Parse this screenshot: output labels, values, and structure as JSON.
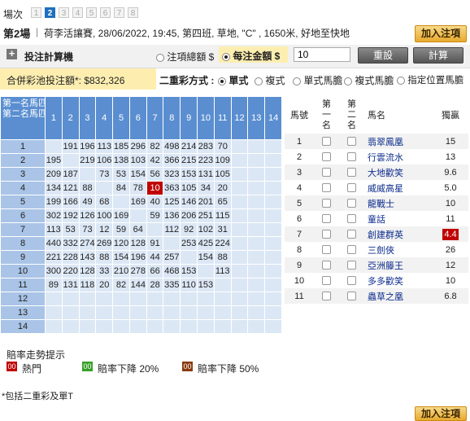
{
  "race_nav": {
    "label": "場次",
    "races": [
      "1",
      "2",
      "3",
      "4",
      "5",
      "6",
      "7",
      "8"
    ],
    "selected": "2"
  },
  "race_info": {
    "race_no": "第2場",
    "details": "荷李活讓賽, 28/06/2022, 19:45, 第四班, 草地, \"C\" , 1650米, 好地至快地"
  },
  "add_bet": "加入注項",
  "calc": {
    "title": "投注計算機",
    "opt_total": "注項總額 $",
    "opt_unit": "每注金額 $",
    "unit_value": "10",
    "reset": "重設",
    "compute": "計算"
  },
  "pool": {
    "label": "合併彩池投注額*: $832,326"
  },
  "quinella": {
    "label": "二重彩方式 :",
    "options": [
      "單式",
      "複式",
      "單式馬膽",
      "複式馬膽",
      "指定位置馬膽"
    ],
    "selected": "單式"
  },
  "matrix": {
    "corner_top": "第一名馬匹",
    "corner_bottom": "第二名馬匹",
    "cols": [
      "1",
      "2",
      "3",
      "4",
      "5",
      "6",
      "7",
      "8",
      "9",
      "10",
      "11",
      "12",
      "13",
      "14"
    ],
    "rows": [
      {
        "n": "1",
        "cells": [
          "",
          "191",
          "196",
          "113",
          "185",
          "296",
          "82",
          "498",
          "214",
          "283",
          "70",
          "",
          "",
          ""
        ]
      },
      {
        "n": "2",
        "cells": [
          "195",
          "",
          "219",
          "106",
          "138",
          "103",
          "42",
          "366",
          "215",
          "223",
          "109",
          "",
          "",
          ""
        ]
      },
      {
        "n": "3",
        "cells": [
          "209",
          "187",
          "",
          "73",
          "53",
          "154",
          "56",
          "323",
          "153",
          "131",
          "105",
          "",
          "",
          ""
        ]
      },
      {
        "n": "4",
        "cells": [
          "134",
          "121",
          "88",
          "",
          "84",
          "78",
          "10",
          "363",
          "105",
          "34",
          "20",
          "",
          "",
          ""
        ]
      },
      {
        "n": "5",
        "cells": [
          "199",
          "166",
          "49",
          "68",
          "",
          "169",
          "40",
          "125",
          "146",
          "201",
          "65",
          "",
          "",
          ""
        ]
      },
      {
        "n": "6",
        "cells": [
          "302",
          "192",
          "126",
          "100",
          "169",
          "",
          "59",
          "136",
          "206",
          "251",
          "115",
          "",
          "",
          ""
        ]
      },
      {
        "n": "7",
        "cells": [
          "113",
          "53",
          "73",
          "12",
          "59",
          "64",
          "",
          "112",
          "92",
          "102",
          "31",
          "",
          "",
          ""
        ]
      },
      {
        "n": "8",
        "cells": [
          "440",
          "332",
          "274",
          "269",
          "120",
          "128",
          "91",
          "",
          "253",
          "425",
          "224",
          "",
          "",
          ""
        ]
      },
      {
        "n": "9",
        "cells": [
          "221",
          "228",
          "143",
          "88",
          "154",
          "196",
          "44",
          "257",
          "",
          "154",
          "88",
          "",
          "",
          ""
        ]
      },
      {
        "n": "10",
        "cells": [
          "300",
          "220",
          "128",
          "33",
          "210",
          "278",
          "66",
          "468",
          "153",
          "",
          "113",
          "",
          "",
          ""
        ]
      },
      {
        "n": "11",
        "cells": [
          "89",
          "131",
          "118",
          "20",
          "82",
          "144",
          "28",
          "335",
          "110",
          "153",
          "",
          "",
          "",
          ""
        ]
      },
      {
        "n": "12",
        "cells": [
          "",
          "",
          "",
          "",
          "",
          "",
          "",
          "",
          "",
          "",
          "",
          "",
          "",
          ""
        ]
      },
      {
        "n": "13",
        "cells": [
          "",
          "",
          "",
          "",
          "",
          "",
          "",
          "",
          "",
          "",
          "",
          "",
          "",
          ""
        ]
      },
      {
        "n": "14",
        "cells": [
          "",
          "",
          "",
          "",
          "",
          "",
          "",
          "",
          "",
          "",
          "",
          "",
          "",
          ""
        ]
      }
    ],
    "hot_cell": {
      "row": "4",
      "col": "7"
    }
  },
  "horses": {
    "headers": {
      "no": "馬號",
      "first": "第一名",
      "second": "第二名",
      "name": "馬名",
      "odds": "獨贏"
    },
    "list": [
      {
        "no": "1",
        "name": "翡翠鳳凰",
        "odds": "15"
      },
      {
        "no": "2",
        "name": "行雲流水",
        "odds": "13"
      },
      {
        "no": "3",
        "name": "大地歡笑",
        "odds": "9.6"
      },
      {
        "no": "4",
        "name": "威威高星",
        "odds": "5.0"
      },
      {
        "no": "5",
        "name": "龍戰士",
        "odds": "10"
      },
      {
        "no": "6",
        "name": "童話",
        "odds": "11"
      },
      {
        "no": "7",
        "name": "創建群英",
        "odds": "4.4",
        "hot": true
      },
      {
        "no": "8",
        "name": "三劍俠",
        "odds": "26"
      },
      {
        "no": "9",
        "name": "亞洲籐王",
        "odds": "12"
      },
      {
        "no": "10",
        "name": "多多歡笑",
        "odds": "10"
      },
      {
        "no": "11",
        "name": "蟲草之凰",
        "odds": "6.8"
      }
    ]
  },
  "legend": {
    "title": "賠率走勢提示",
    "items": [
      {
        "box": "00",
        "label": "熱門",
        "color": "#c00000"
      },
      {
        "box": "00",
        "label": "賠率下降 20%",
        "color": "#38a02a"
      },
      {
        "box": "00",
        "label": "賠率下降 50%",
        "color": "#8a3b10"
      }
    ],
    "footnote": "*包括二重彩及單T"
  }
}
